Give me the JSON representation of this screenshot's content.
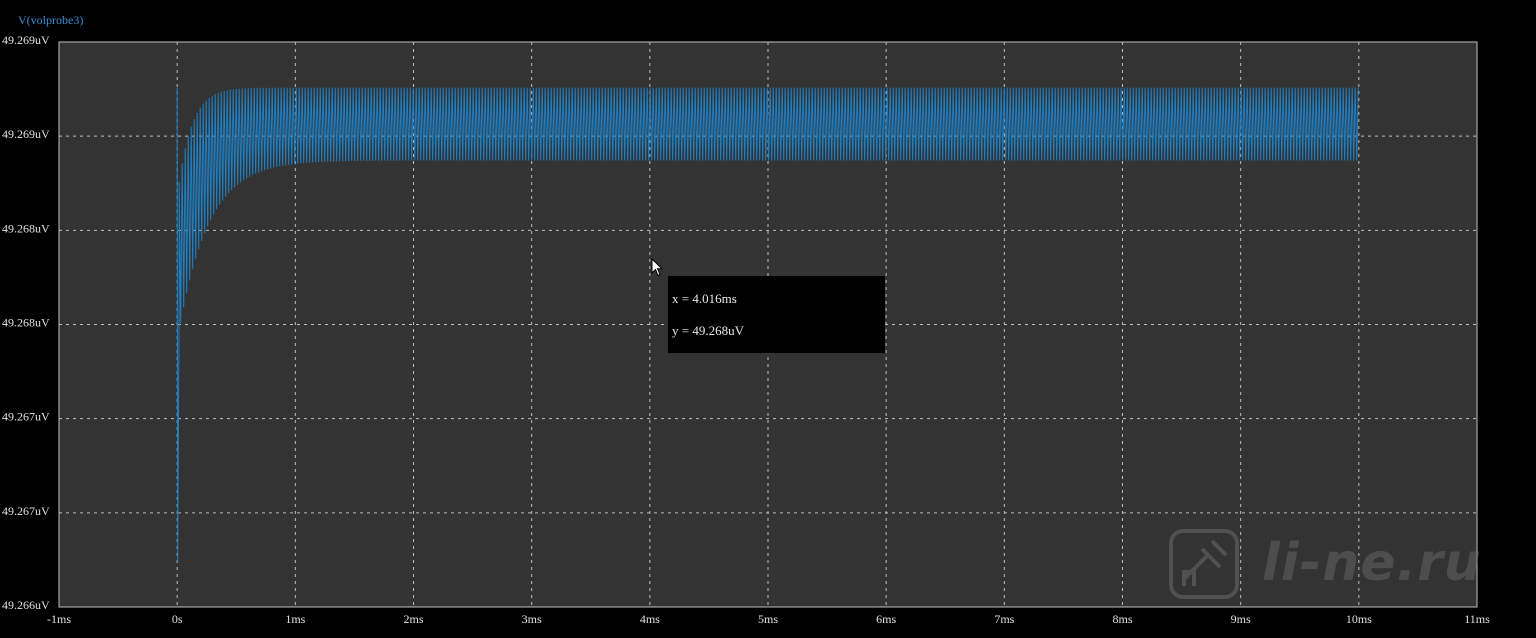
{
  "chart_data": {
    "type": "line",
    "series": [
      {
        "name": "V(volprobe3)",
        "color": "#1f7fc2"
      }
    ],
    "xlim_ms": [
      -1,
      11
    ],
    "x_ticks": [
      "-1ms",
      "0s",
      "1ms",
      "2ms",
      "3ms",
      "4ms",
      "5ms",
      "6ms",
      "7ms",
      "8ms",
      "9ms",
      "10ms",
      "11ms"
    ],
    "y_ticks": [
      "49.269uV",
      "49.269uV",
      "49.268uV",
      "49.268uV",
      "49.267uV",
      "49.267uV",
      "49.266uV"
    ],
    "signal": {
      "start_ms": 0,
      "end_ms": 10,
      "initial_dip_uV": 49.2664,
      "spike_top_uV": 49.269,
      "band_high_uV": 49.269,
      "band_low_uV": 49.2686,
      "description_units": "uV"
    },
    "grid": true,
    "grid_style": "dashed",
    "background": "#333333",
    "frame_color": "#bfbfbf"
  },
  "tooltip": {
    "x_text": "x = 4.016ms",
    "y_text": "y = 49.268uV"
  },
  "watermark": {
    "text": "li-ne.ru"
  }
}
